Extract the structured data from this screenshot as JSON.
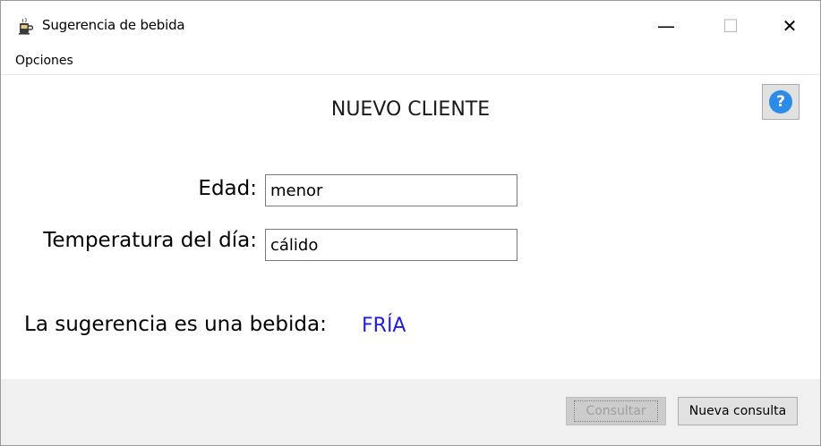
{
  "window": {
    "title": "Sugerencia de bebida",
    "icon": "coffee-cup-icon",
    "controls": {
      "minimize": "—",
      "maximize": "☐",
      "close": "✕"
    }
  },
  "menubar": {
    "items": [
      {
        "label": "Opciones"
      }
    ]
  },
  "main": {
    "heading": "NUEVO CLIENTE",
    "help_button": {
      "glyph": "?",
      "icon": "help-icon",
      "color": "#2b8be6"
    },
    "fields": {
      "edad": {
        "label": "Edad:",
        "value": "menor"
      },
      "temperatura": {
        "label": "Temperatura del día:",
        "value": "cálido"
      }
    },
    "result": {
      "label": "La sugerencia es una bebida:",
      "value": "FRÍA",
      "value_color": "#1f1fe0"
    }
  },
  "footer": {
    "consultar_label": "Consultar",
    "consultar_enabled": false,
    "nueva_consulta_label": "Nueva consulta"
  }
}
